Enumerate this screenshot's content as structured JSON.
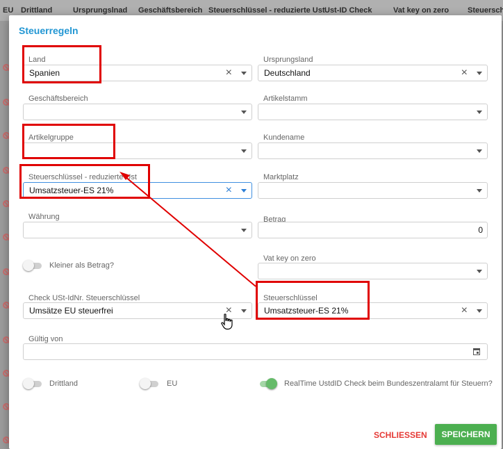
{
  "background_table": {
    "columns": [
      "EU",
      "Drittland",
      "Ursprungslnad",
      "Geschäftsbereich",
      "Steuerschlüssel - reduzierte Ust",
      "Ust-ID Check",
      "Vat key on zero",
      "Steuerschl"
    ]
  },
  "dialog": {
    "title": "Steuerregeln",
    "fields": {
      "land": {
        "label": "Land",
        "value": "Spanien"
      },
      "ursprungsland": {
        "label": "Ursprungsland",
        "value": "Deutschland"
      },
      "geschaeftsbereich": {
        "label": "Geschäftsbereich",
        "value": ""
      },
      "artikelstamm": {
        "label": "Artikelstamm",
        "value": ""
      },
      "artikelgruppe": {
        "label": "Artikelgruppe",
        "value": ""
      },
      "kundename": {
        "label": "Kundename",
        "value": ""
      },
      "steuerschluessel_reduziert": {
        "label": "Steuerschlüssel - reduzierte Ust",
        "value": "Umsatzsteuer-ES 21%"
      },
      "marktplatz": {
        "label": "Marktplatz",
        "value": ""
      },
      "waehrung": {
        "label": "Währung",
        "value": ""
      },
      "betrag": {
        "label": "Betrag",
        "value": "0"
      },
      "vat_key_on_zero": {
        "label": "Vat key on zero",
        "value": ""
      },
      "check_ustid": {
        "label": "Check USt-IdNr. Steuerschlüssel",
        "value": "Umsätze EU steuerfrei"
      },
      "steuerschluessel": {
        "label": "Steuerschlüssel",
        "value": "Umsatzsteuer-ES 21%"
      },
      "gueltig_von": {
        "label": "Gültig von",
        "value": ""
      }
    },
    "toggles": {
      "kleiner_als_betrag": {
        "label": "Kleiner als Betrag?",
        "on": false
      },
      "drittland": {
        "label": "Drittland",
        "on": false
      },
      "eu": {
        "label": "EU",
        "on": false
      },
      "realtime": {
        "label": "RealTime UstdID Check beim Bundeszentralamt für Steuern?",
        "on": true
      }
    },
    "buttons": {
      "close": "SCHLIESSEN",
      "save": "SPEICHERN"
    }
  },
  "colors": {
    "accent": "#2196d3",
    "save": "#4caf50",
    "close": "#e53935",
    "annotation": "#e00000"
  }
}
